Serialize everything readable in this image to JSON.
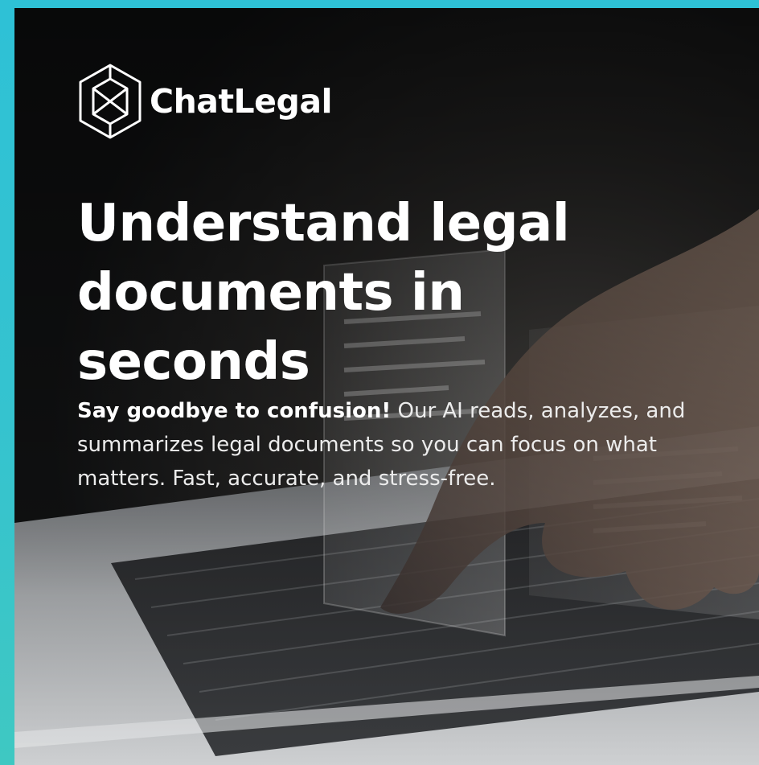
{
  "brand": {
    "name": "ChatLegal",
    "logo_icon": "hexagon-monogram-icon"
  },
  "hero": {
    "headline_lines": [
      "Understand legal",
      "documents in",
      "seconds"
    ],
    "subtext_lead": "Say goodbye to confusion!",
    "subtext_body": " Our AI reads, analyzes, and summarizes legal documents so you can focus on what matters. Fast, accurate, and stress-free."
  },
  "colors": {
    "frame_top": "#2ec1d6",
    "frame_bottom": "#3fc8c2",
    "card_bg": "#141516",
    "text": "#ffffff"
  }
}
